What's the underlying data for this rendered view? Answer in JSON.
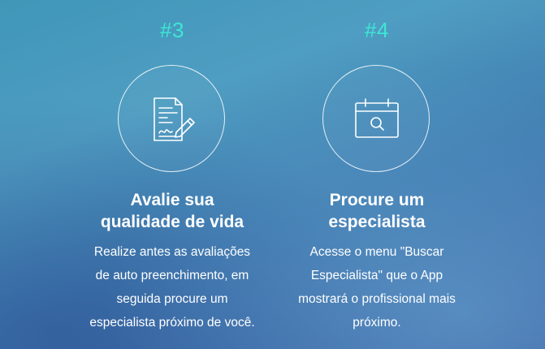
{
  "steps": [
    {
      "number": "#3",
      "icon": "document-signature-icon",
      "title_line1": "Avalie sua",
      "title_line2": "qualidade de vida",
      "desc_lines": [
        "Realize antes as avaliações",
        "de auto preenchimento, em",
        "seguida procure um",
        "especialista próximo de você."
      ]
    },
    {
      "number": "#4",
      "icon": "calendar-search-icon",
      "title_line1": "Procure um",
      "title_line2": "especialista",
      "desc_lines": [
        "Acesse o menu \"Buscar",
        "Especialista\" que o App",
        "mostrará o profissional mais",
        "próximo."
      ]
    }
  ],
  "colors": {
    "accent": "#3ee6d4",
    "text": "#ffffff"
  }
}
